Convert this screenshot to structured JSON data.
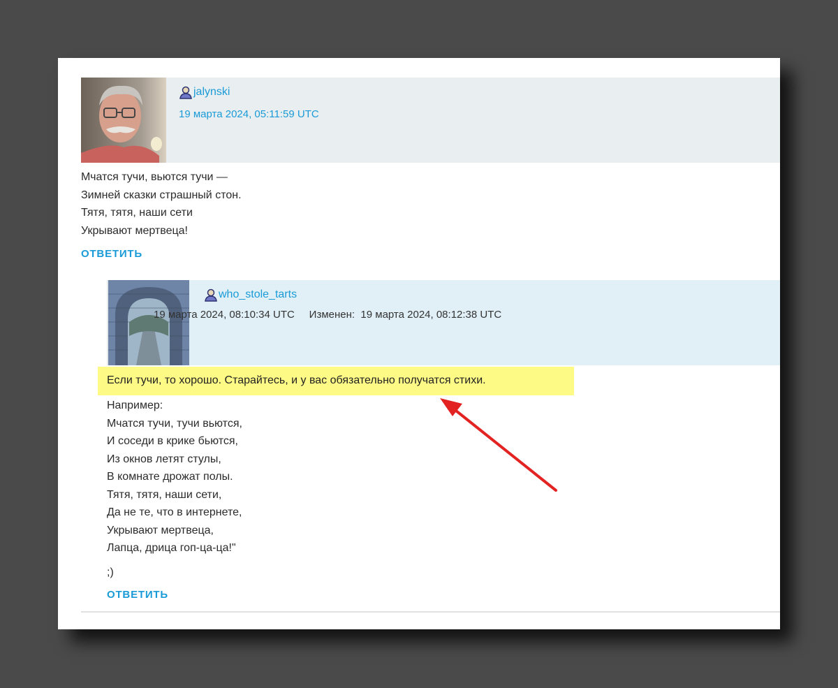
{
  "comment1": {
    "author": "jalynski",
    "date": "19 марта 2024, 05:11:59 UTC",
    "lines": [
      "Мчатся тучи, вьются тучи —",
      "Зимней сказки страшный стон.",
      "Тятя, тятя, наши сети",
      "Укрывают мертвеца!"
    ],
    "reply_label": "ОТВЕТИТЬ"
  },
  "comment2": {
    "author": "who_stole_tarts",
    "date": "19 марта 2024, 08:10:34 UTC",
    "edited_label": "Изменен:",
    "edited_date": "19 марта 2024, 08:12:38 UTC",
    "highlight": "Если тучи, то хорошо. Старайтесь, и у вас обязательно получатся стихи.",
    "lines": [
      "Например:",
      "Мчатся тучи, тучи вьются,",
      "И соседи в крике бьются,",
      "Из окнов летят стулы,",
      "В комнате дрожат полы.",
      "Тятя, тятя, наши сети,",
      "Да не те, что в интернете,",
      "Укрывают мертвеца,",
      "Лапца, дрица гоп-ца-ца!\""
    ],
    "wink": ";)",
    "reply_label": "ОТВЕТИТЬ"
  },
  "colors": {
    "link": "#1a9bd7",
    "highlight": "#fdfa85",
    "arrow": "#e32222"
  },
  "icons": [
    "user-icon",
    "avatar-photo",
    "red-arrow"
  ]
}
